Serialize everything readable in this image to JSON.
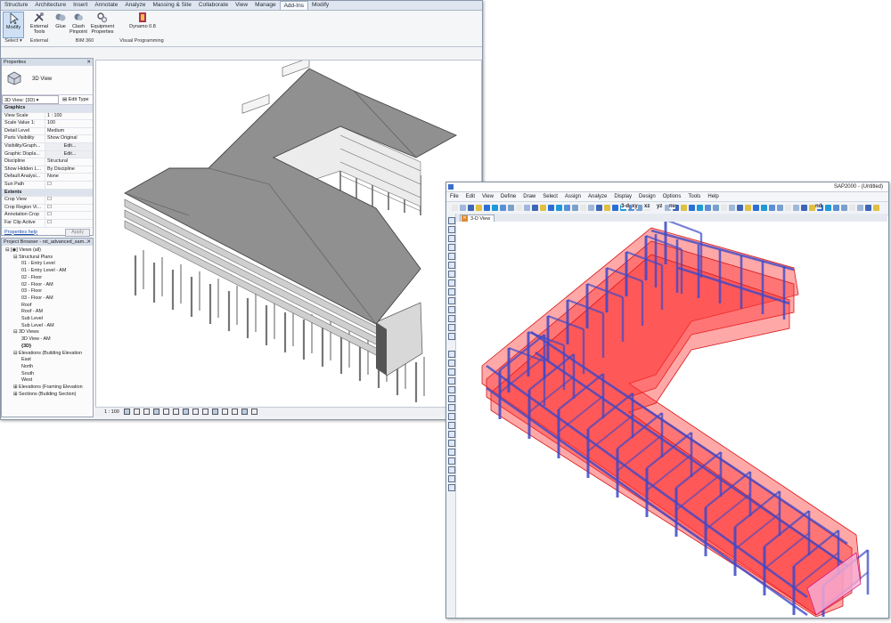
{
  "revit": {
    "tabs": [
      "Structure",
      "Architecture",
      "Insert",
      "Annotate",
      "Analyze",
      "Massing & Site",
      "Collaborate",
      "View",
      "Manage",
      "Add-Ins",
      "Modify"
    ],
    "active_tab": "Add-Ins",
    "ribbon": {
      "modify": "Modify",
      "select": "Select ▾",
      "external_tools": "External Tools",
      "external": "External",
      "glue": "Glue",
      "clash": "Clash Pinpoint",
      "equipment": "Equipment Properties",
      "bim360": "BIM 360",
      "dynamo": "Dynamo 0.8",
      "visual_programming": "Visual Programming"
    },
    "properties": {
      "title": "Properties",
      "type_name": "3D View",
      "selector": "3D View: {3D}",
      "edit_type": "Edit Type",
      "rows": [
        {
          "k": "Graphics",
          "v": "",
          "hdr": true
        },
        {
          "k": "View Scale",
          "v": "1 : 100"
        },
        {
          "k": "Scale Value 1:",
          "v": "100"
        },
        {
          "k": "Detail Level",
          "v": "Medium"
        },
        {
          "k": "Parts Visibility",
          "v": "Show Original"
        },
        {
          "k": "Visibility/Graph...",
          "v": "Edit..."
        },
        {
          "k": "Graphic Displa...",
          "v": "Edit..."
        },
        {
          "k": "Discipline",
          "v": "Structural"
        },
        {
          "k": "Show Hidden L...",
          "v": "By Discipline"
        },
        {
          "k": "Default Analysi...",
          "v": "None"
        },
        {
          "k": "Sun Path",
          "v": "☐"
        },
        {
          "k": "Extents",
          "v": "",
          "hdr": true
        },
        {
          "k": "Crop View",
          "v": "☐"
        },
        {
          "k": "Crop Region Vi...",
          "v": "☐"
        },
        {
          "k": "Annotation Crop",
          "v": "☐"
        },
        {
          "k": "Far Clip Active",
          "v": "☐"
        }
      ],
      "help": "Properties help",
      "apply": "Apply"
    },
    "browser": {
      "title": "Project Browser - rst_advanced_sam...",
      "items": [
        {
          "t": "⊟ [◉] Views (all)",
          "d": 0
        },
        {
          "t": "⊟ Structural Plans",
          "d": 1
        },
        {
          "t": "01 - Entry Level",
          "d": 2
        },
        {
          "t": "01 - Entry Level - AM",
          "d": 2
        },
        {
          "t": "02 - Floor",
          "d": 2
        },
        {
          "t": "02 - Floor - AM",
          "d": 2
        },
        {
          "t": "03 - Floor",
          "d": 2
        },
        {
          "t": "03 - Floor - AM",
          "d": 2
        },
        {
          "t": "Roof",
          "d": 2
        },
        {
          "t": "Roof - AM",
          "d": 2
        },
        {
          "t": "Sub Level",
          "d": 2
        },
        {
          "t": "Sub Level - AM",
          "d": 2
        },
        {
          "t": "⊟ 3D Views",
          "d": 1
        },
        {
          "t": "3D View - AM",
          "d": 2
        },
        {
          "t": "{3D}",
          "d": 2,
          "b": true
        },
        {
          "t": "⊟ Elevations (Building Elevation",
          "d": 1
        },
        {
          "t": "East",
          "d": 2
        },
        {
          "t": "North",
          "d": 2
        },
        {
          "t": "South",
          "d": 2
        },
        {
          "t": "West",
          "d": 2
        },
        {
          "t": "⊞ Elevations (Framing Elevation",
          "d": 1
        },
        {
          "t": "⊞ Sections (Building Section)",
          "d": 1
        }
      ]
    },
    "status_scale": "1 : 100"
  },
  "sap": {
    "title": "SAP2000 - (Untitled)",
    "menu": [
      "File",
      "Edit",
      "View",
      "Define",
      "Draw",
      "Select",
      "Assign",
      "Analyze",
      "Display",
      "Design",
      "Options",
      "Tools",
      "Help"
    ],
    "toolbar_text": [
      "3-d",
      "xy",
      "xz",
      "yz",
      "nv",
      "nd"
    ],
    "view_tab": "3-D View"
  },
  "colors": {
    "revit_roof": "#909090",
    "sap_shell": "#ff3030",
    "sap_frame": "#3c48c8"
  }
}
